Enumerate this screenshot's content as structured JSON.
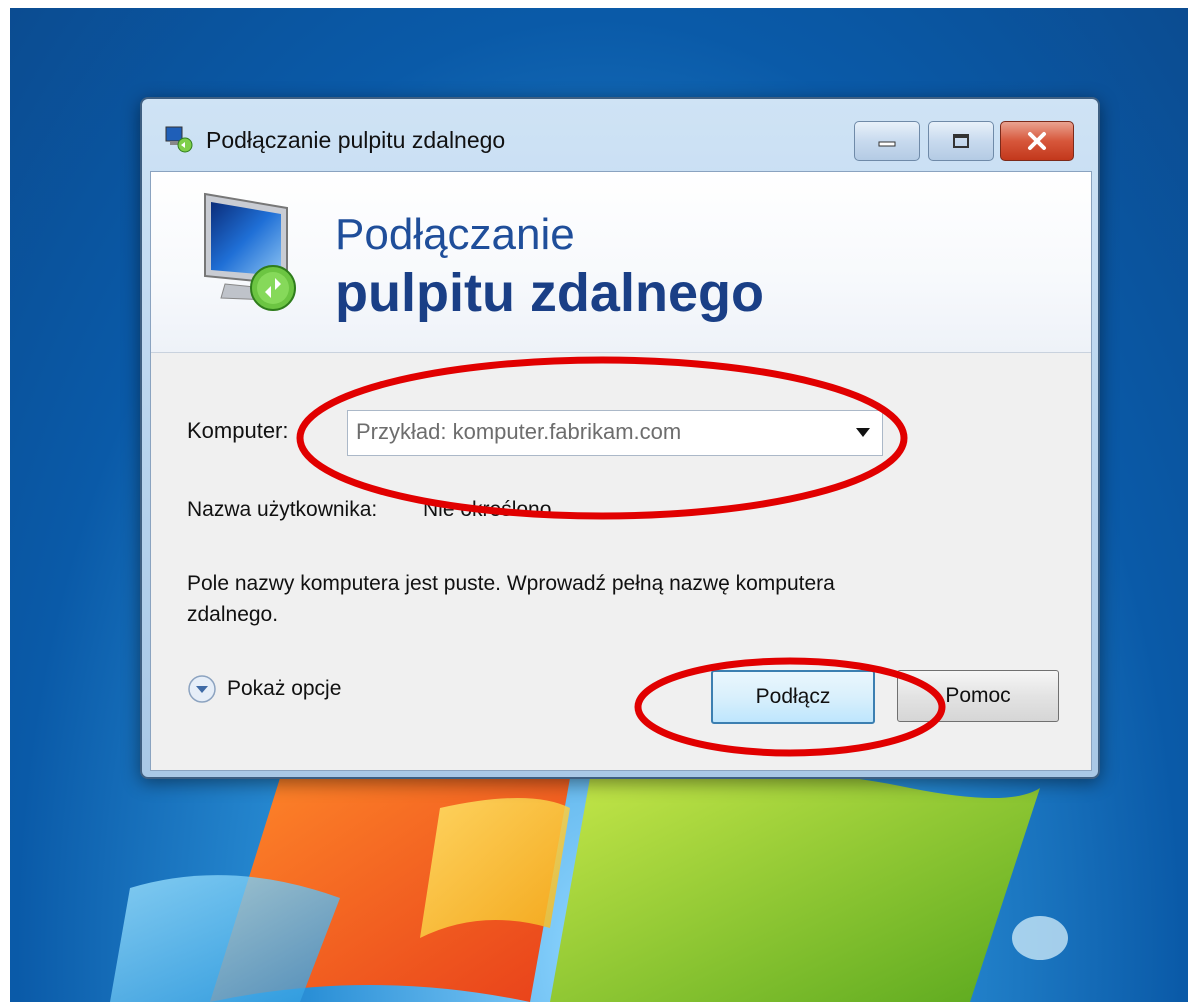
{
  "window": {
    "title": "Podłączanie pulpitu zdalnego",
    "controls": {
      "minimize": "minimize",
      "maximize": "maximize",
      "close": "close"
    }
  },
  "banner": {
    "line1": "Podłączanie",
    "line2": "pulpitu zdalnego"
  },
  "form": {
    "computer_label": "Komputer:",
    "computer_placeholder": "Przykład: komputer.fabrikam.com",
    "user_label": "Nazwa użytkownika:",
    "user_value": "Nie określono",
    "message": "Pole nazwy komputera jest puste. Wprowadź pełną nazwę komputera zdalnego."
  },
  "footer": {
    "options_label": "Pokaż opcje",
    "connect_label": "Podłącz",
    "help_label": "Pomoc"
  },
  "icons": {
    "title": "remote-desktop-icon",
    "banner": "monitor-remote-icon",
    "options": "expand-chevron-icon",
    "dropdown": "dropdown-arrow-icon"
  },
  "colors": {
    "annotation": "#e10000",
    "banner_text": "#1a3f86",
    "close_button": "#c2381c"
  }
}
